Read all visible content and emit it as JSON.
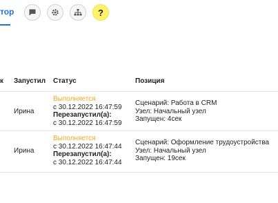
{
  "top_tab": {
    "label": "тор"
  },
  "toolbar": {
    "chat_icon": "chat-bubble-icon",
    "settings_icon": "gear-icon",
    "hierarchy_icon": "org-chart-icon",
    "help_label": "?"
  },
  "table": {
    "columns": [
      "к",
      "Запустил",
      "Статус",
      "Позиция"
    ],
    "rows": [
      {
        "started_by": "Ирина",
        "status": "Выполняется",
        "status_since": "с 30.12.2022 16:47:59",
        "restarted_label": "Перезапустил(а):",
        "restarted_since": "с 30.12.2022 16:47:59",
        "scenario": "Сценарий: Работа в CRM",
        "node": "Узел: Начальный узел",
        "started_ago": "Запущен: 4сек"
      },
      {
        "started_by": "Ирина",
        "status": "Выполняется",
        "status_since": "с 30.12.2022 16:47:44",
        "restarted_label": "Перезапустил(а):",
        "restarted_since": "с 30.12.2022 16:47:44",
        "scenario": "Сценарий: Оформление трудоустройства",
        "node": "Узел: Начальный узел",
        "started_ago": "Запущен: 19сек"
      }
    ]
  },
  "colors": {
    "accent": "#1976d2",
    "running": "#f5a623",
    "help_bg": "#fff36b"
  }
}
